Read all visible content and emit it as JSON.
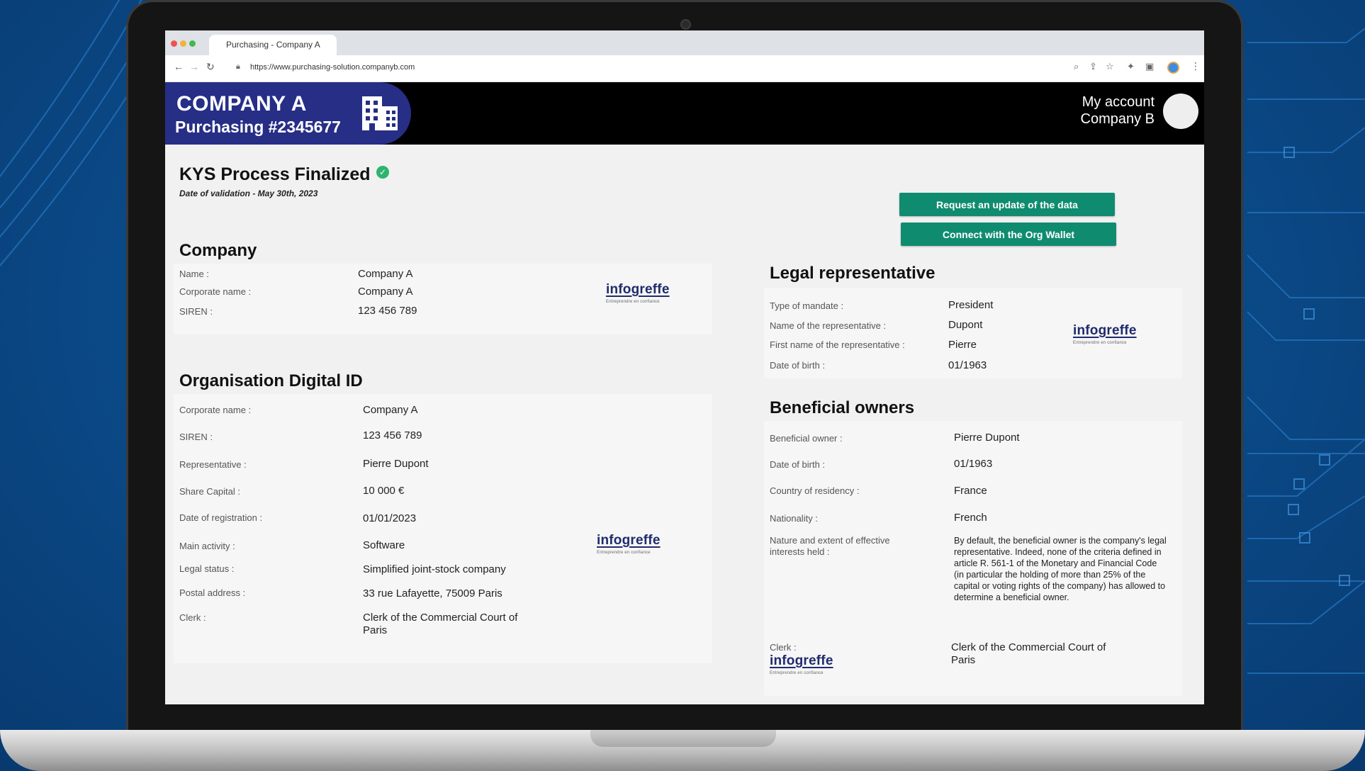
{
  "browser": {
    "tab_title": "Purchasing - Company A",
    "url": "https://www.purchasing-solution.companyb.com"
  },
  "header": {
    "brand_title": "COMPANY A",
    "brand_subtitle": "Purchasing #2345677",
    "account_label": "My account",
    "account_company": "Company B"
  },
  "status": {
    "title": "KYS Process Finalized",
    "validation": "Date of validation - May 30th, 2023"
  },
  "actions": {
    "request_update": "Request an update of the data",
    "connect_wallet": "Connect with the Org Wallet"
  },
  "logo": {
    "word": "infogreffe",
    "tagline": "Entreprendre en confiance"
  },
  "company": {
    "title": "Company",
    "rows": [
      {
        "label": "Name :",
        "value": "Company A"
      },
      {
        "label": "Corporate name :",
        "value": "Company A"
      },
      {
        "label": "SIREN :",
        "value": "123 456 789"
      }
    ]
  },
  "odid": {
    "title": "Organisation Digital ID",
    "rows": [
      {
        "label": "Corporate name :",
        "value": "Company A"
      },
      {
        "label": "SIREN :",
        "value": "123 456 789"
      },
      {
        "label": "Representative :",
        "value": "Pierre Dupont"
      },
      {
        "label": "Share Capital :",
        "value": "10 000 €"
      },
      {
        "label": "Date of registration :",
        "value": "01/01/2023"
      },
      {
        "label": "Main activity :",
        "value": "Software"
      },
      {
        "label": "Legal status :",
        "value": "Simplified joint-stock company"
      },
      {
        "label": "Postal address :",
        "value": "33 rue Lafayette, 75009 Paris"
      },
      {
        "label": "Clerk :",
        "value": "Clerk of the Commercial Court of Paris"
      }
    ]
  },
  "legal": {
    "title": "Legal representative",
    "rows": [
      {
        "label": "Type of mandate :",
        "value": "President"
      },
      {
        "label": "Name of the representative :",
        "value": "Dupont"
      },
      {
        "label": "First name of the representative :",
        "value": "Pierre"
      },
      {
        "label": "Date of birth :",
        "value": "01/1963"
      }
    ]
  },
  "owners": {
    "title": "Beneficial owners",
    "rows": [
      {
        "label": "Beneficial owner :",
        "value": "Pierre Dupont"
      },
      {
        "label": "Date of birth :",
        "value": "01/1963"
      },
      {
        "label": "Country of residency :",
        "value": "France"
      },
      {
        "label": "Nationality :",
        "value": "French"
      },
      {
        "label": "Nature and extent of effective interests held :",
        "value": "By default, the beneficial owner is the company's legal representative. Indeed, none of the criteria defined in article R. 561-1 of the Monetary and Financial Code (in particular the holding of more than 25% of the capital or voting rights of the company) has allowed to determine a beneficial owner."
      },
      {
        "label": "Clerk :",
        "value": "Clerk of the Commercial Court of Paris"
      }
    ]
  }
}
